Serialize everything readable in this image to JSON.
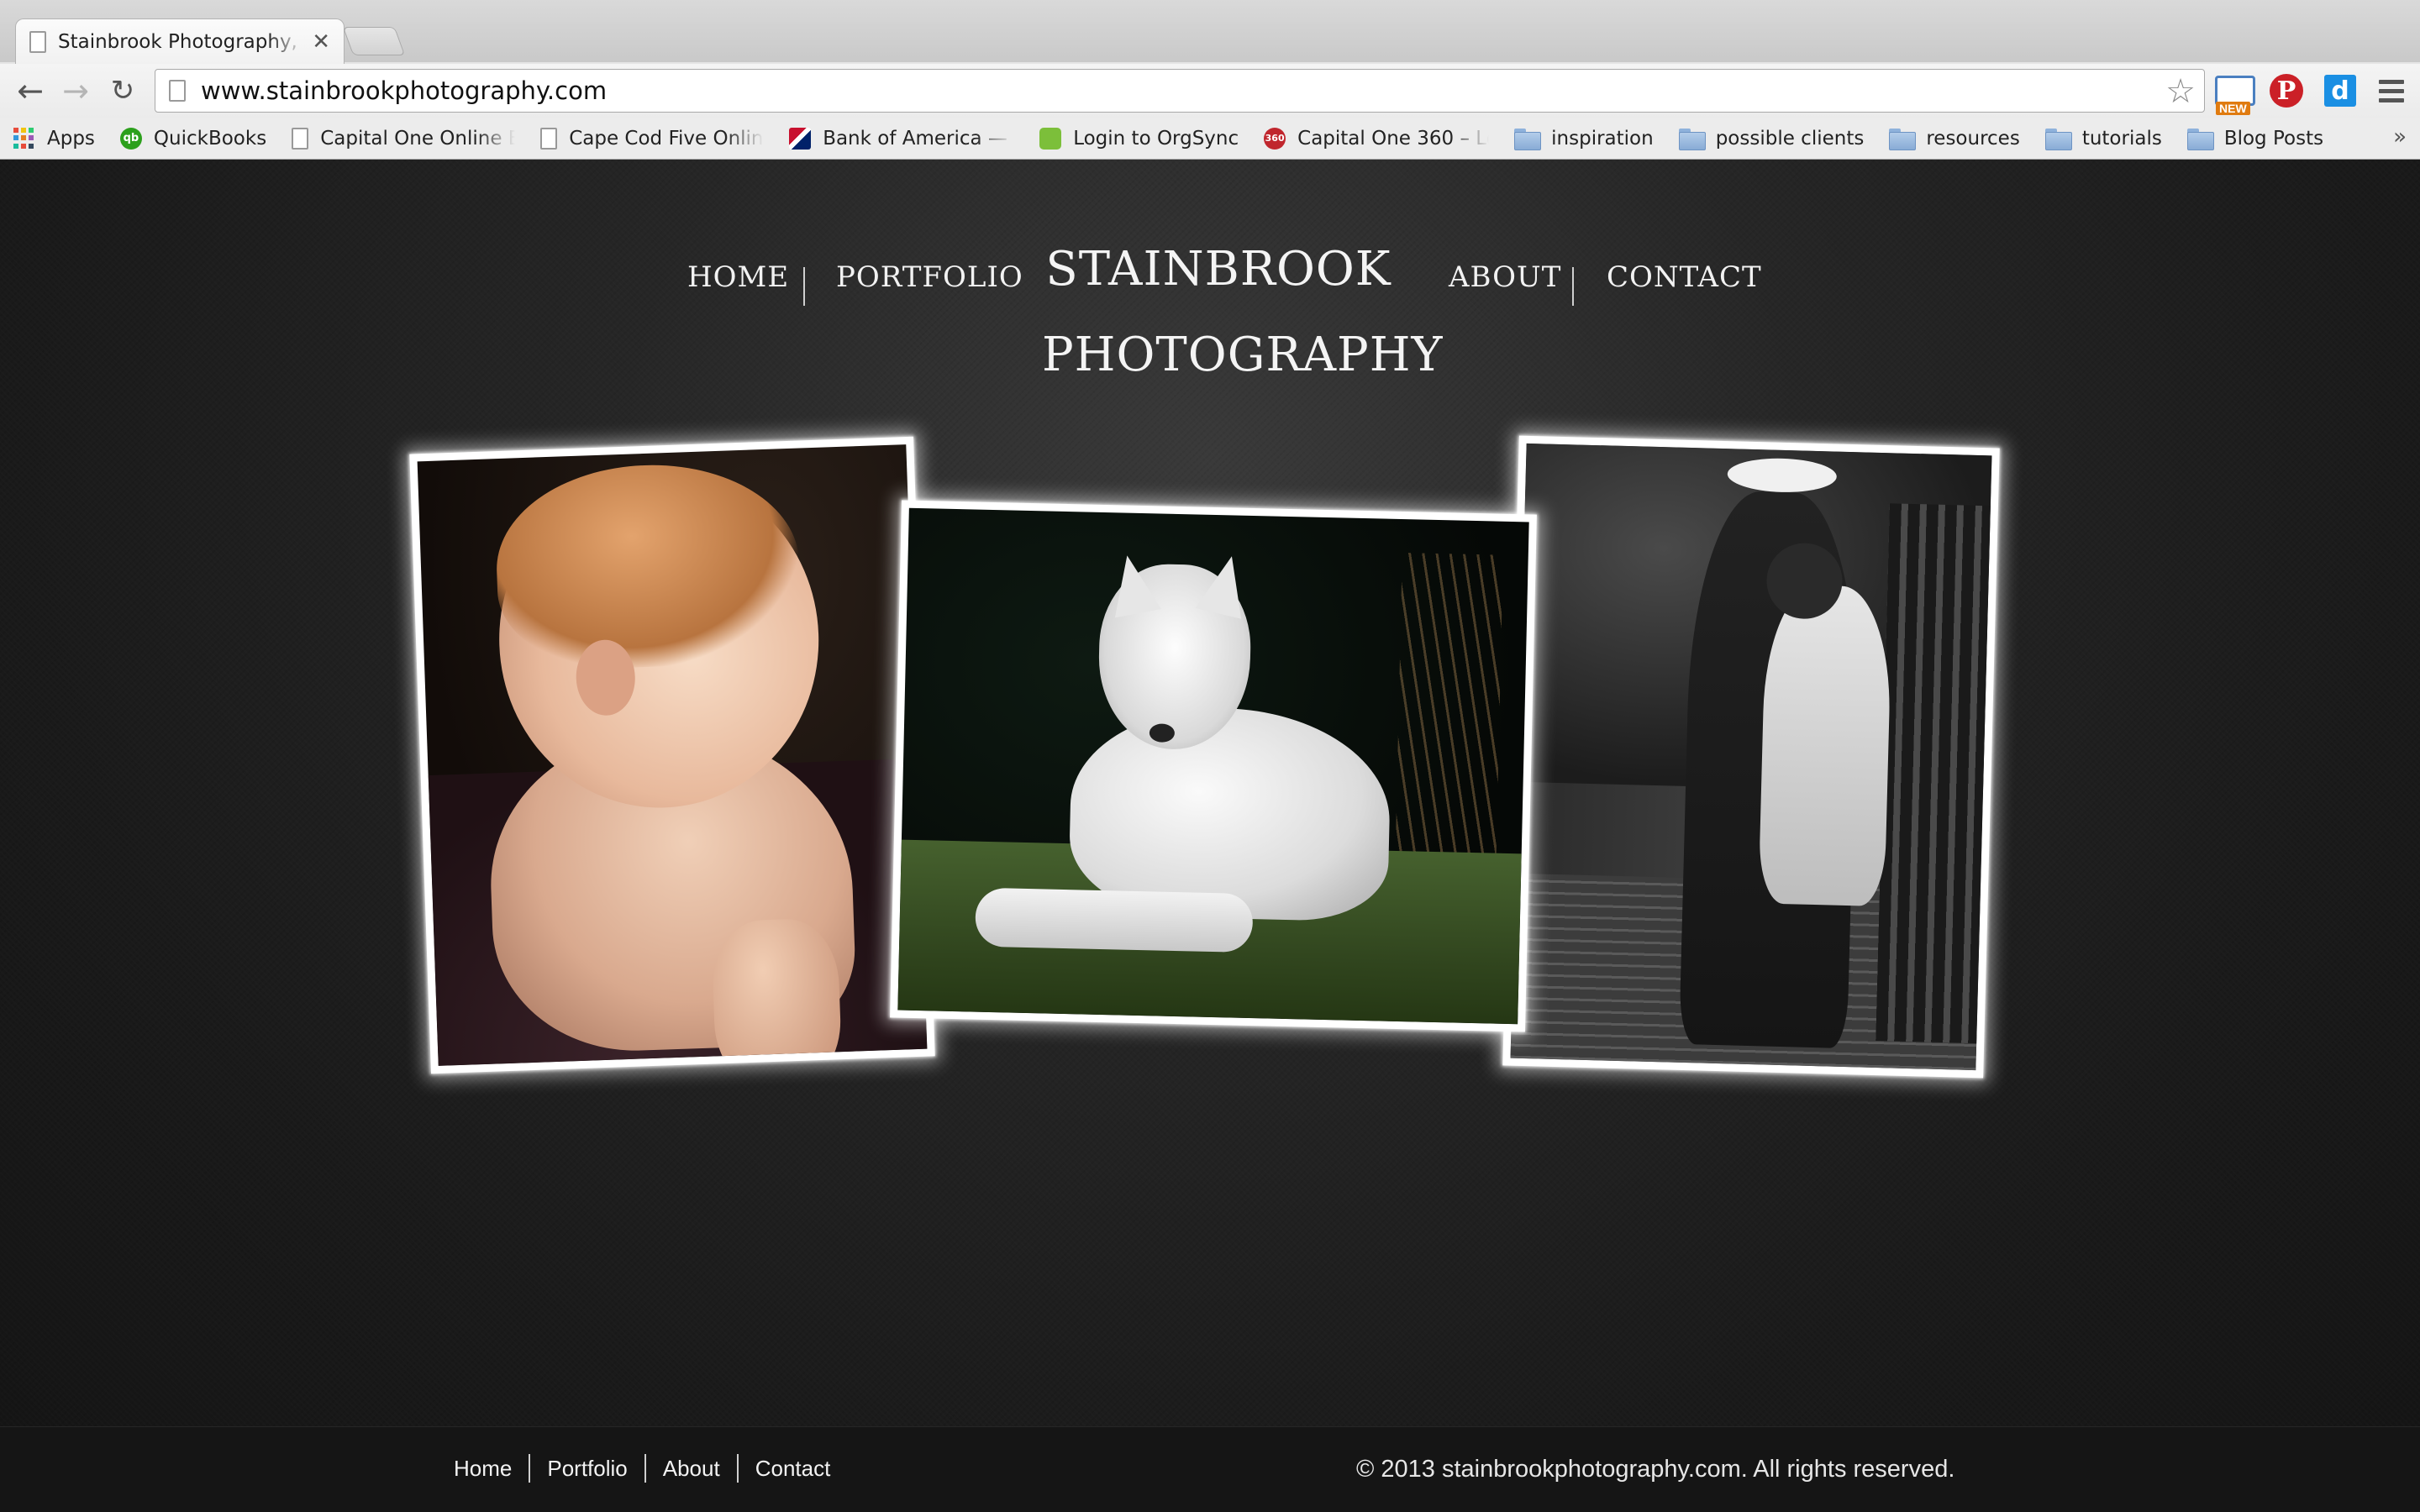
{
  "browser": {
    "tab_title": "Stainbrook Photography, S",
    "url": "www.stainbrookphotography.com",
    "extensions": {
      "new_badge": "NEW",
      "pinterest": "P",
      "d": "d"
    },
    "bookmarks": [
      {
        "label": "Apps",
        "icon": "apps-grid-icon"
      },
      {
        "label": "QuickBooks",
        "icon": "quickbooks-icon"
      },
      {
        "label": "Capital One Online B",
        "icon": "page-icon"
      },
      {
        "label": "Cape Cod Five Online",
        "icon": "page-icon"
      },
      {
        "label": "Bank of America — B",
        "icon": "bank-of-america-icon"
      },
      {
        "label": "Login to OrgSync",
        "icon": "orgsync-icon"
      },
      {
        "label": "Capital One 360 – Lo",
        "icon": "capital-one-360-icon"
      },
      {
        "label": "inspiration",
        "icon": "folder-icon"
      },
      {
        "label": "possible clients",
        "icon": "folder-icon"
      },
      {
        "label": "resources",
        "icon": "folder-icon"
      },
      {
        "label": "tutorials",
        "icon": "folder-icon"
      },
      {
        "label": "Blog Posts",
        "icon": "folder-icon"
      }
    ]
  },
  "site": {
    "logo_line1": "STAINBROOK",
    "logo_line2": "PHOTOGRAPHY",
    "nav": {
      "home": "HOME",
      "portfolio": "PORTFOLIO",
      "about": "ABOUT",
      "contact": "CONTACT"
    },
    "footer": {
      "links": [
        "Home",
        "Portfolio",
        "About",
        "Contact"
      ],
      "copyright": "© 2013 stainbrookphotography.com. All rights reserved."
    }
  }
}
